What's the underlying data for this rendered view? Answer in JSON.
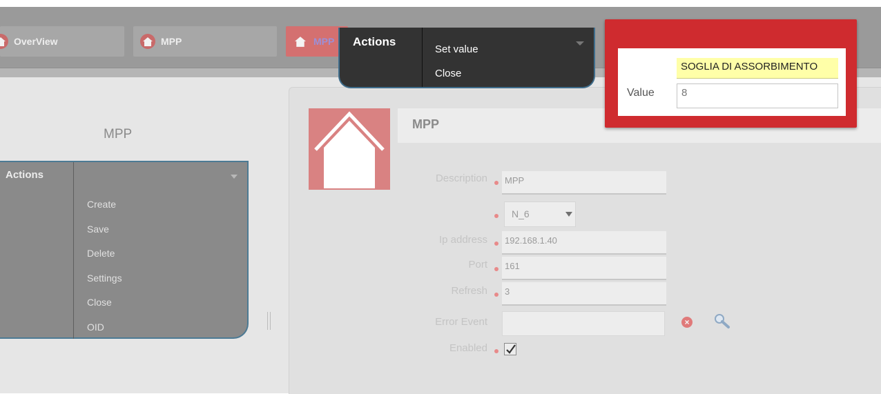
{
  "tabs": [
    {
      "label": "OverView"
    },
    {
      "label": "MPP"
    },
    {
      "label": "MPP"
    }
  ],
  "left_panel": {
    "title": "MPP",
    "actions_label": "Actions",
    "menu_items": [
      "Create",
      "Save",
      "Delete",
      "Settings",
      "Close",
      "OID"
    ]
  },
  "form": {
    "header_title": "MPP",
    "description_label": "Description",
    "description_value": "MPP",
    "select_value": "N_6",
    "ip_label": "Ip address",
    "ip_value": "192.168.1.40",
    "port_label": "Port",
    "port_value": "161",
    "refresh_label": "Refresh",
    "refresh_value": "3",
    "error_event_label": "Error Event",
    "error_event_value": "",
    "enabled_label": "Enabled",
    "enabled_checked": true
  },
  "actions_popup": {
    "label": "Actions",
    "items": [
      "Set value",
      "Close"
    ]
  },
  "value_dialog": {
    "title": "SOGLIA DI ASSORBIMENTO",
    "value_label": "Value",
    "value": "8",
    "accent_color": "#cf2b2f"
  },
  "colors": {
    "required_marker": "#e88a8a",
    "overlay_popup": "#333333",
    "popup_border": "#3f6d8c"
  }
}
